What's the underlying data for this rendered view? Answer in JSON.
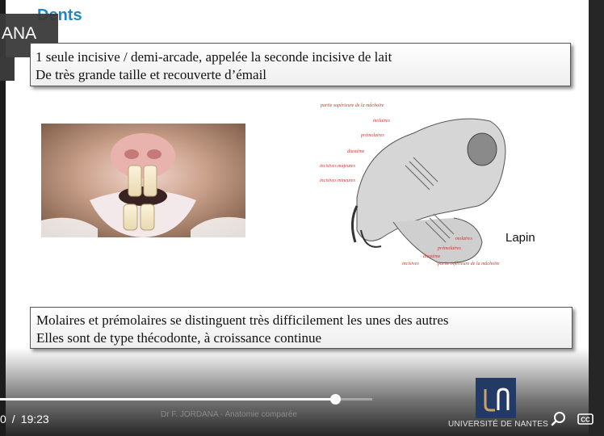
{
  "slide": {
    "title": "Dents",
    "box1_lines": [
      "1 seule incisive / demi-arcade, appelée la seconde incisive de lait",
      "De très grande taille et recouverte d’émail"
    ],
    "box2_lines": [
      "Molaires et prémolaires se distinguent très difficilement les unes des autres",
      "Elles sont de type thécodonte, à croissance continue"
    ],
    "figure_label": "Lapin",
    "diagram_labels": {
      "top": "partie supérieure de la mâchoire",
      "molaires": "molaires",
      "premolaires": "prémolaires",
      "diastème": "diastème",
      "incisives_majeures": "incisives majeures",
      "incisives_mineures": "incisives mineures",
      "molaires_bas": "molaires",
      "premolaires_bas": "prémolaires",
      "diasteme_bas": "diastème",
      "incisives": "incisives",
      "bottom": "partie inférieure de la mâchoire"
    },
    "footer_credit": "Dr F. JORDANA - Anatomie comparée",
    "university": "UNIVERSITÉ DE NANTES",
    "logo_text": "u n"
  },
  "speaker_tag": "ANA",
  "player": {
    "current_time": "0",
    "duration": "19:23",
    "separator": "/",
    "progress_fraction": 0.9,
    "search_icon": "search-icon",
    "cc_icon": "closed-captions-icon",
    "cc_label": "CC"
  },
  "colors": {
    "title": "#1f86c8",
    "diagram_labels": "#c0392b",
    "logo_bg": "#243a66"
  }
}
